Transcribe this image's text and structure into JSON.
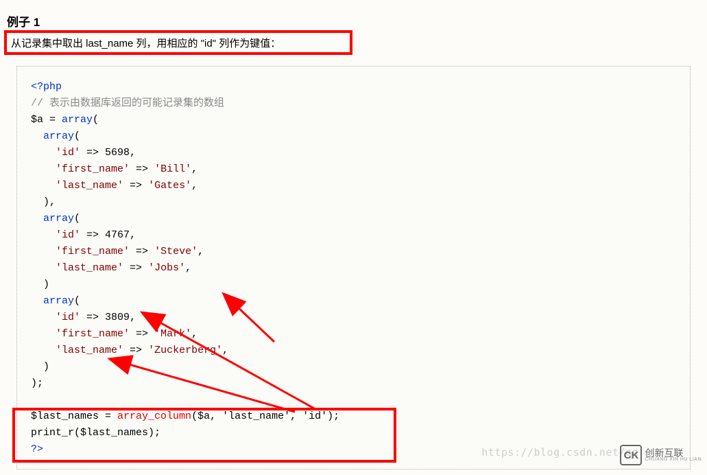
{
  "heading": "例子 1",
  "description": "从记录集中取出 last_name 列，用相应的 \"id\" 列作为键值：",
  "code": {
    "open_tag": "<?php",
    "comment": "// 表示由数据库返回的可能记录集的数组",
    "assign": "$a = ",
    "array_kw": "array",
    "rows": [
      {
        "id": "5698",
        "first_name": "Bill",
        "last_name": "Gates"
      },
      {
        "id": "4767",
        "first_name": "Steve",
        "last_name": "Jobs"
      },
      {
        "id": "3809",
        "first_name": "Mark",
        "last_name": "Zuckerberg"
      }
    ],
    "result_var": "$last_names = ",
    "result_fn": "array_column",
    "result_args": "($a, 'last_name', 'id');",
    "print_line": "print_r($last_names);",
    "close_tag": "?>"
  },
  "watermark": "https://blog.csdn.net/qq",
  "logo": {
    "mark": "CK",
    "text": "创新互联",
    "sub": "CHUANG XIN HU LIAN"
  }
}
